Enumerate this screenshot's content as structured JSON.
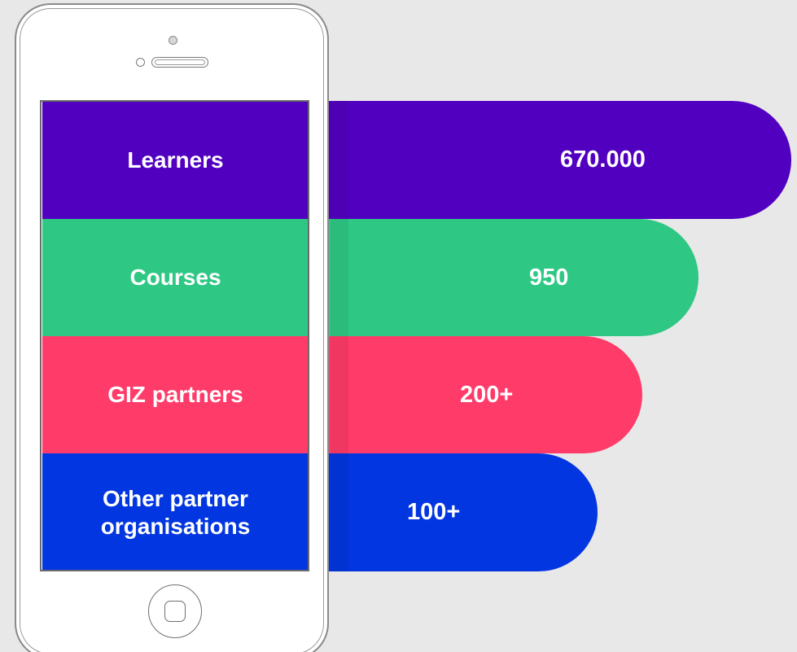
{
  "chart_data": {
    "type": "bar",
    "categories": [
      "Learners",
      "Courses",
      "GIZ partners",
      "Other partner organisations"
    ],
    "category_lines": [
      [
        "Learners"
      ],
      [
        "Courses"
      ],
      [
        "GIZ partners"
      ],
      [
        "Other partner",
        "organisations"
      ]
    ],
    "value_labels": [
      "670.000",
      "950",
      "200+",
      "100+"
    ],
    "colors": [
      "#5200c0",
      "#2ec884",
      "#ff3b69",
      "#0236e0"
    ]
  }
}
